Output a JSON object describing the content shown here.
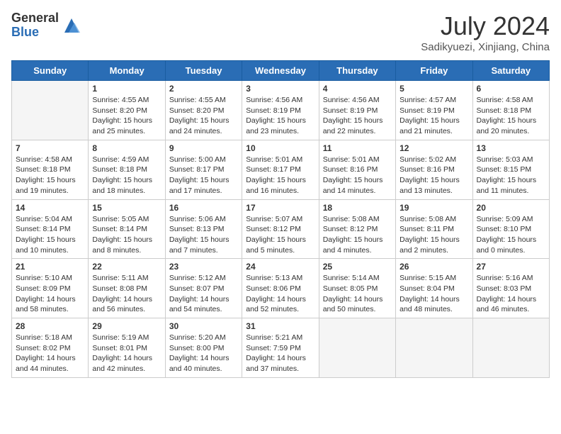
{
  "header": {
    "logo_general": "General",
    "logo_blue": "Blue",
    "month_year": "July 2024",
    "location": "Sadikyuezi, Xinjiang, China"
  },
  "days_of_week": [
    "Sunday",
    "Monday",
    "Tuesday",
    "Wednesday",
    "Thursday",
    "Friday",
    "Saturday"
  ],
  "weeks": [
    [
      {
        "day": "",
        "info": ""
      },
      {
        "day": "1",
        "info": "Sunrise: 4:55 AM\nSunset: 8:20 PM\nDaylight: 15 hours\nand 25 minutes."
      },
      {
        "day": "2",
        "info": "Sunrise: 4:55 AM\nSunset: 8:20 PM\nDaylight: 15 hours\nand 24 minutes."
      },
      {
        "day": "3",
        "info": "Sunrise: 4:56 AM\nSunset: 8:19 PM\nDaylight: 15 hours\nand 23 minutes."
      },
      {
        "day": "4",
        "info": "Sunrise: 4:56 AM\nSunset: 8:19 PM\nDaylight: 15 hours\nand 22 minutes."
      },
      {
        "day": "5",
        "info": "Sunrise: 4:57 AM\nSunset: 8:19 PM\nDaylight: 15 hours\nand 21 minutes."
      },
      {
        "day": "6",
        "info": "Sunrise: 4:58 AM\nSunset: 8:18 PM\nDaylight: 15 hours\nand 20 minutes."
      }
    ],
    [
      {
        "day": "7",
        "info": "Sunrise: 4:58 AM\nSunset: 8:18 PM\nDaylight: 15 hours\nand 19 minutes."
      },
      {
        "day": "8",
        "info": "Sunrise: 4:59 AM\nSunset: 8:18 PM\nDaylight: 15 hours\nand 18 minutes."
      },
      {
        "day": "9",
        "info": "Sunrise: 5:00 AM\nSunset: 8:17 PM\nDaylight: 15 hours\nand 17 minutes."
      },
      {
        "day": "10",
        "info": "Sunrise: 5:01 AM\nSunset: 8:17 PM\nDaylight: 15 hours\nand 16 minutes."
      },
      {
        "day": "11",
        "info": "Sunrise: 5:01 AM\nSunset: 8:16 PM\nDaylight: 15 hours\nand 14 minutes."
      },
      {
        "day": "12",
        "info": "Sunrise: 5:02 AM\nSunset: 8:16 PM\nDaylight: 15 hours\nand 13 minutes."
      },
      {
        "day": "13",
        "info": "Sunrise: 5:03 AM\nSunset: 8:15 PM\nDaylight: 15 hours\nand 11 minutes."
      }
    ],
    [
      {
        "day": "14",
        "info": "Sunrise: 5:04 AM\nSunset: 8:14 PM\nDaylight: 15 hours\nand 10 minutes."
      },
      {
        "day": "15",
        "info": "Sunrise: 5:05 AM\nSunset: 8:14 PM\nDaylight: 15 hours\nand 8 minutes."
      },
      {
        "day": "16",
        "info": "Sunrise: 5:06 AM\nSunset: 8:13 PM\nDaylight: 15 hours\nand 7 minutes."
      },
      {
        "day": "17",
        "info": "Sunrise: 5:07 AM\nSunset: 8:12 PM\nDaylight: 15 hours\nand 5 minutes."
      },
      {
        "day": "18",
        "info": "Sunrise: 5:08 AM\nSunset: 8:12 PM\nDaylight: 15 hours\nand 4 minutes."
      },
      {
        "day": "19",
        "info": "Sunrise: 5:08 AM\nSunset: 8:11 PM\nDaylight: 15 hours\nand 2 minutes."
      },
      {
        "day": "20",
        "info": "Sunrise: 5:09 AM\nSunset: 8:10 PM\nDaylight: 15 hours\nand 0 minutes."
      }
    ],
    [
      {
        "day": "21",
        "info": "Sunrise: 5:10 AM\nSunset: 8:09 PM\nDaylight: 14 hours\nand 58 minutes."
      },
      {
        "day": "22",
        "info": "Sunrise: 5:11 AM\nSunset: 8:08 PM\nDaylight: 14 hours\nand 56 minutes."
      },
      {
        "day": "23",
        "info": "Sunrise: 5:12 AM\nSunset: 8:07 PM\nDaylight: 14 hours\nand 54 minutes."
      },
      {
        "day": "24",
        "info": "Sunrise: 5:13 AM\nSunset: 8:06 PM\nDaylight: 14 hours\nand 52 minutes."
      },
      {
        "day": "25",
        "info": "Sunrise: 5:14 AM\nSunset: 8:05 PM\nDaylight: 14 hours\nand 50 minutes."
      },
      {
        "day": "26",
        "info": "Sunrise: 5:15 AM\nSunset: 8:04 PM\nDaylight: 14 hours\nand 48 minutes."
      },
      {
        "day": "27",
        "info": "Sunrise: 5:16 AM\nSunset: 8:03 PM\nDaylight: 14 hours\nand 46 minutes."
      }
    ],
    [
      {
        "day": "28",
        "info": "Sunrise: 5:18 AM\nSunset: 8:02 PM\nDaylight: 14 hours\nand 44 minutes."
      },
      {
        "day": "29",
        "info": "Sunrise: 5:19 AM\nSunset: 8:01 PM\nDaylight: 14 hours\nand 42 minutes."
      },
      {
        "day": "30",
        "info": "Sunrise: 5:20 AM\nSunset: 8:00 PM\nDaylight: 14 hours\nand 40 minutes."
      },
      {
        "day": "31",
        "info": "Sunrise: 5:21 AM\nSunset: 7:59 PM\nDaylight: 14 hours\nand 37 minutes."
      },
      {
        "day": "",
        "info": ""
      },
      {
        "day": "",
        "info": ""
      },
      {
        "day": "",
        "info": ""
      }
    ]
  ]
}
